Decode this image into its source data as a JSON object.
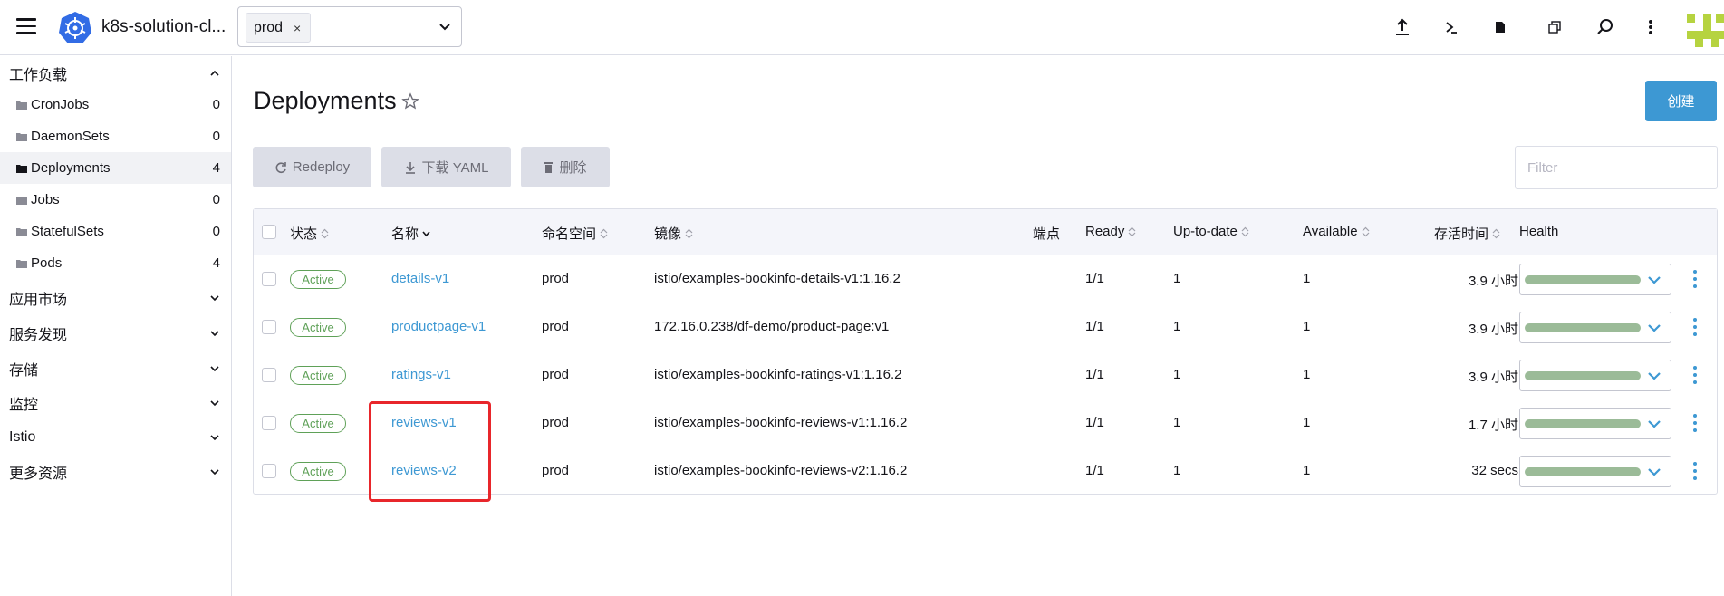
{
  "header": {
    "cluster_name": "k8s-solution-cl...",
    "namespace_chip": "prod",
    "chip_close": "×",
    "icons": [
      "upload-icon",
      "terminal-icon",
      "file-icon",
      "copy-icon",
      "search-icon",
      "more-vertical-icon"
    ]
  },
  "sidebar": {
    "groups": [
      {
        "label": "工作负载",
        "expanded": true
      },
      {
        "label": "应用市场",
        "expanded": false
      },
      {
        "label": "服务发现",
        "expanded": false
      },
      {
        "label": "存储",
        "expanded": false
      },
      {
        "label": "监控",
        "expanded": false
      },
      {
        "label": "Istio",
        "expanded": false
      },
      {
        "label": "更多资源",
        "expanded": false
      }
    ],
    "items": [
      {
        "label": "CronJobs",
        "count": "0",
        "active": false
      },
      {
        "label": "DaemonSets",
        "count": "0",
        "active": false
      },
      {
        "label": "Deployments",
        "count": "4",
        "active": true
      },
      {
        "label": "Jobs",
        "count": "0",
        "active": false
      },
      {
        "label": "StatefulSets",
        "count": "0",
        "active": false
      },
      {
        "label": "Pods",
        "count": "4",
        "active": false
      }
    ]
  },
  "main": {
    "title": "Deployments",
    "create_label": "创建",
    "toolbar": {
      "redeploy_label": "Redeploy",
      "download_label": "下载 YAML",
      "delete_label": "删除"
    },
    "filter_placeholder": "Filter",
    "columns": {
      "state": "状态",
      "name": "名称",
      "namespace": "命名空间",
      "image": "镜像",
      "endpoints": "端点",
      "ready": "Ready",
      "uptodate": "Up-to-date",
      "available": "Available",
      "age": "存活时间",
      "health": "Health"
    },
    "rows": [
      {
        "state": "Active",
        "name": "details-v1",
        "namespace": "prod",
        "image": "istio/examples-bookinfo-details-v1:1.16.2",
        "ready": "1/1",
        "uptodate": "1",
        "available": "1",
        "age": "3.9 小时",
        "health": 1.0
      },
      {
        "state": "Active",
        "name": "productpage-v1",
        "namespace": "prod",
        "image": "172.16.0.238/df-demo/product-page:v1",
        "ready": "1/1",
        "uptodate": "1",
        "available": "1",
        "age": "3.9 小时",
        "health": 1.0
      },
      {
        "state": "Active",
        "name": "ratings-v1",
        "namespace": "prod",
        "image": "istio/examples-bookinfo-ratings-v1:1.16.2",
        "ready": "1/1",
        "uptodate": "1",
        "available": "1",
        "age": "3.9 小时",
        "health": 1.0
      },
      {
        "state": "Active",
        "name": "reviews-v1",
        "namespace": "prod",
        "image": "istio/examples-bookinfo-reviews-v1:1.16.2",
        "ready": "1/1",
        "uptodate": "1",
        "available": "1",
        "age": "1.7 小时",
        "health": 1.0
      },
      {
        "state": "Active",
        "name": "reviews-v2",
        "namespace": "prod",
        "image": "istio/examples-bookinfo-reviews-v2:1.16.2",
        "ready": "1/1",
        "uptodate": "1",
        "available": "1",
        "age": "32 secs",
        "health": 1.0
      }
    ]
  },
  "colors": {
    "accent": "#3d98d3",
    "active_badge": "#5fa158",
    "health_bar": "#9bbb98",
    "highlight": "#e8262b"
  }
}
